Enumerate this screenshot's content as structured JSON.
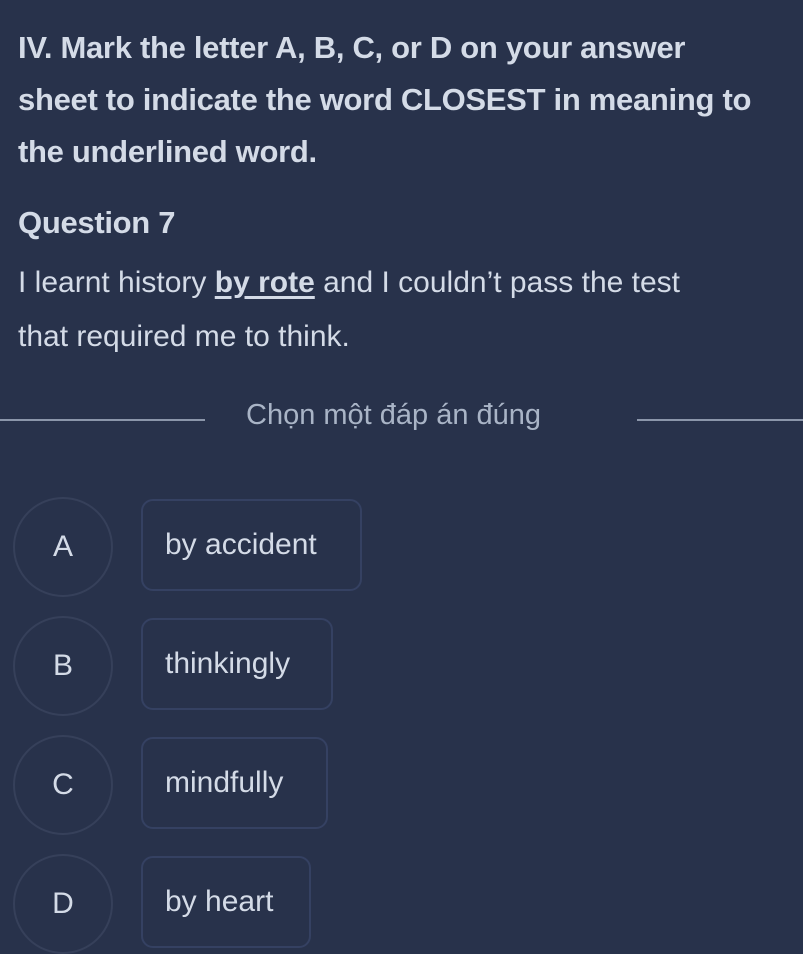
{
  "instruction": {
    "lines": [
      "IV. Mark the letter A, B, C, or D on your answer",
      "sheet to indicate the word CLOSEST in meaning to",
      "the underlined word."
    ]
  },
  "question": {
    "title": "Question 7",
    "line1_before": "I learnt history ",
    "underlined": "by rote",
    "line1_after": " and I couldn’t pass the test",
    "line2": "that required me to think."
  },
  "prompt": "Chọn một đáp án đúng",
  "options": [
    {
      "letter": "A",
      "text": "by accident"
    },
    {
      "letter": "B",
      "text": "thinkingly"
    },
    {
      "letter": "C",
      "text": "mindfully"
    },
    {
      "letter": "D",
      "text": "by heart"
    }
  ],
  "colors": {
    "background": "#28324b",
    "text": "#d4dbe7",
    "border": "#354162"
  }
}
